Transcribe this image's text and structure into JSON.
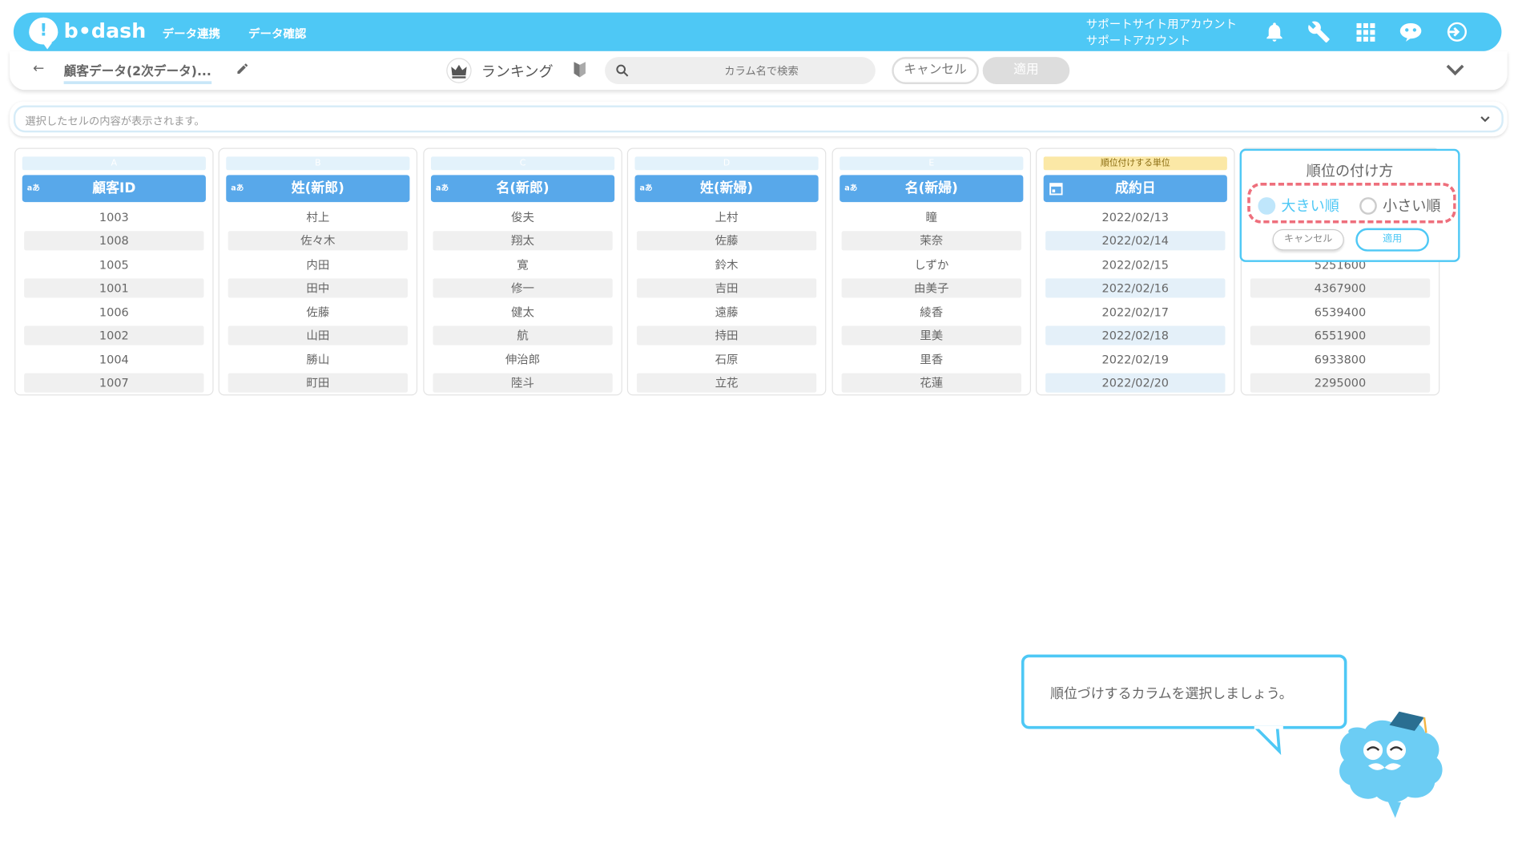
{
  "header": {
    "logo": "b•dash",
    "nav": [
      "データ連携",
      "データ確認"
    ],
    "account_line1": "サポートサイト用アカウント",
    "account_line2": "サポートアカウント",
    "icons": [
      "bell-icon",
      "wrench-icon",
      "grid-icon",
      "chat-bot-icon",
      "logout-icon"
    ]
  },
  "toolbar": {
    "back_icon": "arrow-left-icon",
    "dataset_name": "顧客データ(2次データ)...",
    "mode_label": "ランキング",
    "search_placeholder": "カラム名で検索",
    "cancel_label": "キャンセル",
    "apply_label": "適用"
  },
  "cellbar": {
    "placeholder": "選択したセルの内容が表示されます。"
  },
  "columns": [
    {
      "letter": "A",
      "name": "顧客ID",
      "type": "aあ",
      "cells": [
        "1003",
        "1008",
        "1005",
        "1001",
        "1006",
        "1002",
        "1004",
        "1007"
      ]
    },
    {
      "letter": "B",
      "name": "姓(新郎)",
      "type": "aあ",
      "cells": [
        "村上",
        "佐々木",
        "内田",
        "田中",
        "佐藤",
        "山田",
        "勝山",
        "町田"
      ]
    },
    {
      "letter": "C",
      "name": "名(新郎)",
      "type": "aあ",
      "cells": [
        "俊夫",
        "翔太",
        "寛",
        "修一",
        "健太",
        "航",
        "伸治郎",
        "陸斗"
      ]
    },
    {
      "letter": "D",
      "name": "姓(新婦)",
      "type": "aあ",
      "cells": [
        "上村",
        "佐藤",
        "鈴木",
        "吉田",
        "遠藤",
        "持田",
        "石原",
        "立花"
      ]
    },
    {
      "letter": "E",
      "name": "名(新婦)",
      "type": "aあ",
      "cells": [
        "瞳",
        "茉奈",
        "しずか",
        "由美子",
        "綾香",
        "里美",
        "里香",
        "花蓮"
      ]
    },
    {
      "letter": "順位付けする単位",
      "name": "成約日",
      "type": "calendar",
      "cells": [
        "2022/02/13",
        "2022/02/14",
        "2022/02/15",
        "2022/02/16",
        "2022/02/17",
        "2022/02/18",
        "2022/02/19",
        "2022/02/20"
      ]
    },
    {
      "letter": "",
      "name": "",
      "type": "",
      "cells": [
        "5251600",
        "4367900",
        "6539400",
        "6551900",
        "6933800",
        "2295000"
      ]
    }
  ],
  "popover": {
    "title": "順位の付け方",
    "option_desc": "大きい順",
    "option_asc": "小さい順",
    "selected": "大きい順",
    "cancel_label": "キャンセル",
    "apply_label": "適用"
  },
  "tutorial": {
    "message": "順位づけするカラムを選択しましょう。"
  },
  "colors": {
    "brand": "#4ec8f5",
    "header_column": "#58a8ea",
    "highlight": "#ee6f7c"
  }
}
